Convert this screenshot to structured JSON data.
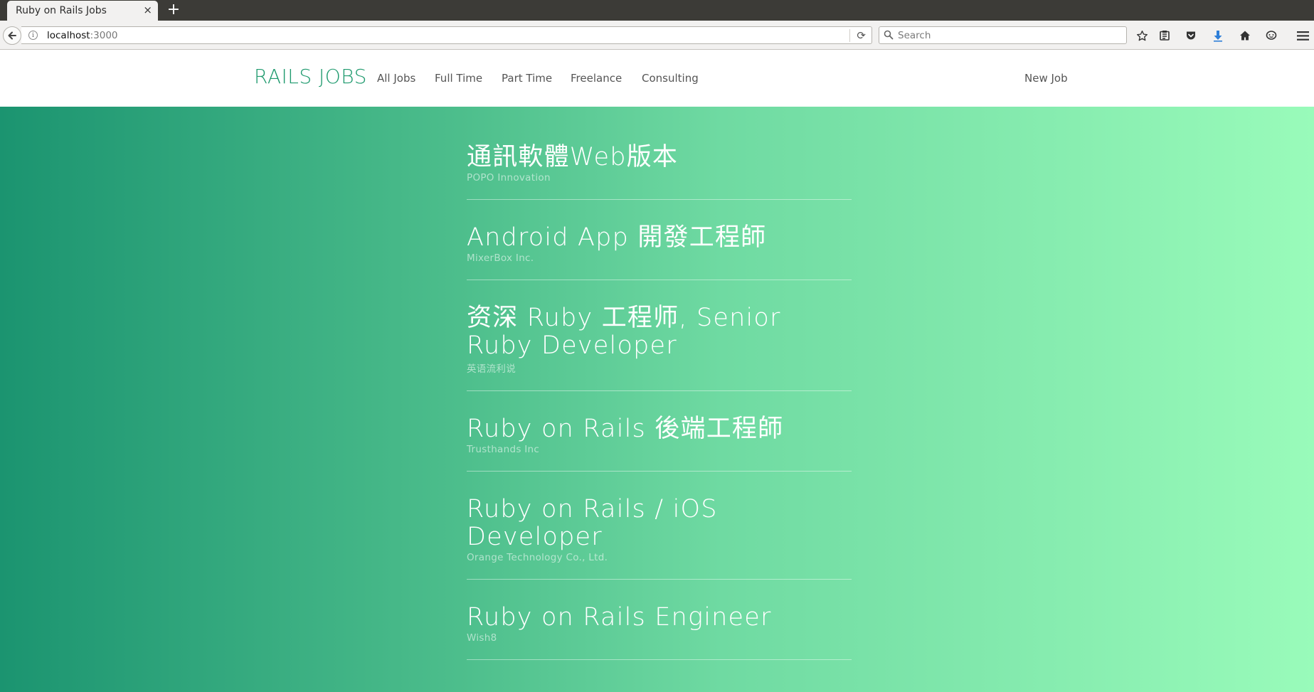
{
  "browser": {
    "tab_title": "Ruby on Rails Jobs",
    "tab_close": "×",
    "new_tab": "+",
    "url_host": "localhost",
    "url_port": ":3000",
    "search_placeholder": "Search",
    "toolbar_icons": [
      "back-icon",
      "info-icon",
      "reload-icon",
      "search-icon",
      "star-icon",
      "reading-list-icon",
      "pocket-icon",
      "download-icon",
      "home-icon",
      "chat-icon",
      "menu-icon"
    ]
  },
  "header": {
    "brand": "RAILS JOBS",
    "nav": [
      "All Jobs",
      "Full Time",
      "Part Time",
      "Freelance",
      "Consulting"
    ],
    "new_job": "New Job"
  },
  "jobs": [
    {
      "title": "通訊軟體Web版本",
      "company": "POPO Innovation"
    },
    {
      "title": "Android App 開發工程師",
      "company": "MixerBox Inc."
    },
    {
      "title": "资深 Ruby 工程师, Senior Ruby Developer",
      "company": "英语流利说"
    },
    {
      "title": "Ruby on Rails 後端工程師",
      "company": "Trusthands Inc"
    },
    {
      "title": "Ruby on Rails / iOS Developer",
      "company": "Orange Technology Co., Ltd."
    },
    {
      "title": "Ruby on Rails Engineer",
      "company": "Wish8"
    }
  ],
  "colors": {
    "brand": "#1f9a6e",
    "gradient_start": "#1b9470",
    "gradient_end": "#99fbba"
  }
}
